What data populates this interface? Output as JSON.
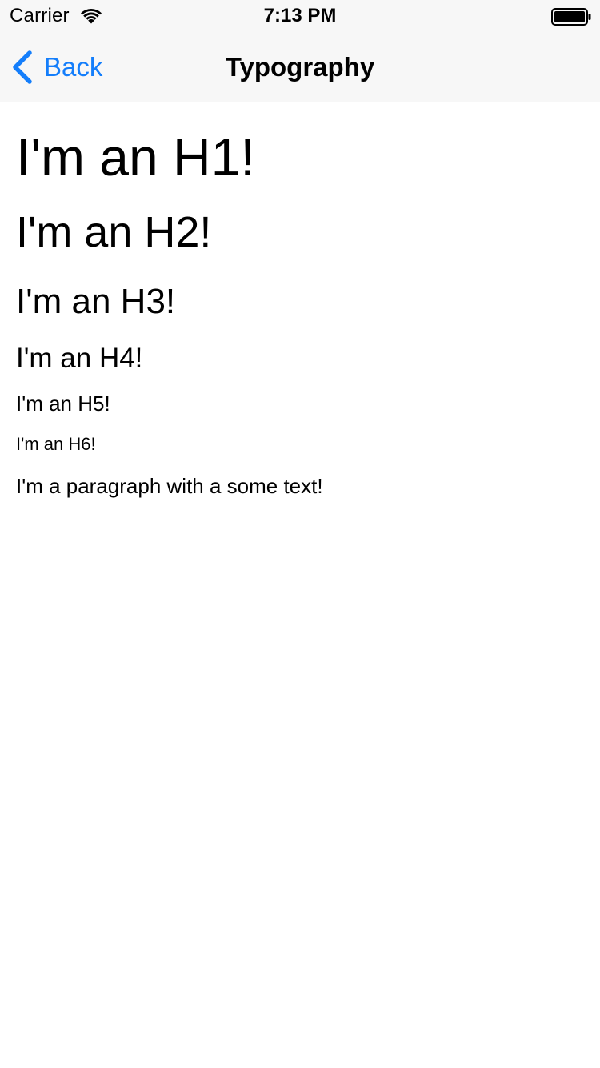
{
  "status_bar": {
    "carrier": "Carrier",
    "time": "7:13 PM",
    "wifi_icon": "wifi-icon",
    "battery_icon": "battery-icon"
  },
  "nav_bar": {
    "back_label": "Back",
    "back_icon": "chevron-left-icon",
    "title": "Typography"
  },
  "content": {
    "h1": "I'm an H1!",
    "h2": "I'm an H2!",
    "h3": "I'm an H3!",
    "h4": "I'm an H4!",
    "h5": "I'm an H5!",
    "h6": "I'm an H6!",
    "paragraph": "I'm a paragraph with a some text!"
  },
  "colors": {
    "accent": "#147efb",
    "bar_background": "#f7f7f7",
    "separator": "#b2b2b2",
    "text": "#000000"
  }
}
